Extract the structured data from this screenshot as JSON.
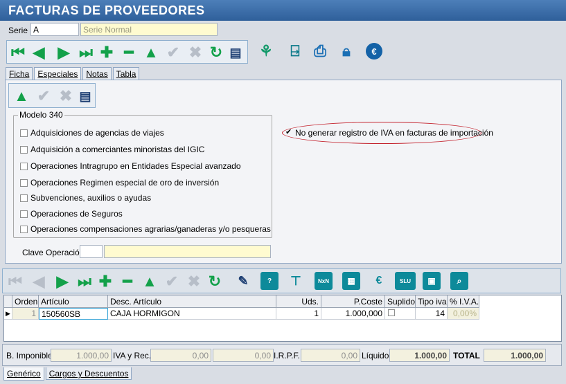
{
  "window": {
    "title": "FACTURAS DE PROVEEDORES"
  },
  "serie": {
    "label": "Serie",
    "code": "A",
    "name_placeholder": "Serie Normal"
  },
  "tabs": [
    {
      "label": "Ficha"
    },
    {
      "label": "Especiales"
    },
    {
      "label": "Notas"
    },
    {
      "label": "Tabla"
    }
  ],
  "modelo340": {
    "title": "Modelo 340",
    "options": [
      "Adquisiciones de agencias de viajes",
      "Adquisición a comerciantes minoristas del IGIC",
      "Operaciones Intragrupo en Entidades Especial avanzado",
      "Operaciones Regimen especial de oro de inversión",
      "Subvenciones, auxilios o ayudas",
      "Operaciones de Seguros",
      "Operaciones compensaciones agrarias/ganaderas y/o pesqueras"
    ],
    "clave_label": "Clave Operación"
  },
  "no_iva": {
    "label": "No generar registro de IVA en facturas de importación",
    "checked": true
  },
  "lines_grid": {
    "headers": [
      "Orden",
      "Artículo",
      "Desc. Artículo",
      "Uds.",
      "P.Coste",
      "Suplido",
      "Tipo iva",
      "% I.V.A."
    ],
    "rows": [
      {
        "orden": "1",
        "articulo": "150560SB",
        "desc": "CAJA HORMIGON",
        "uds": "1",
        "pcoste": "1.000,000",
        "tipo_iva": "14",
        "pct_iva": "0,00%"
      }
    ]
  },
  "totals": {
    "base_label": "B. Imponible",
    "base": "1.000,00",
    "iva_label": "IVA y Rec.",
    "iva": "0,00",
    "rec": "0,00",
    "irpf_label": "I.R.P.F.",
    "irpf": "0,00",
    "liquido_label": "Líquido",
    "liquido": "1.000,00",
    "total_label": "TOTAL",
    "total": "1.000,00"
  },
  "bottom_tabs": [
    {
      "label": "Genérico"
    },
    {
      "label": "Cargos y Descuentos"
    }
  ]
}
